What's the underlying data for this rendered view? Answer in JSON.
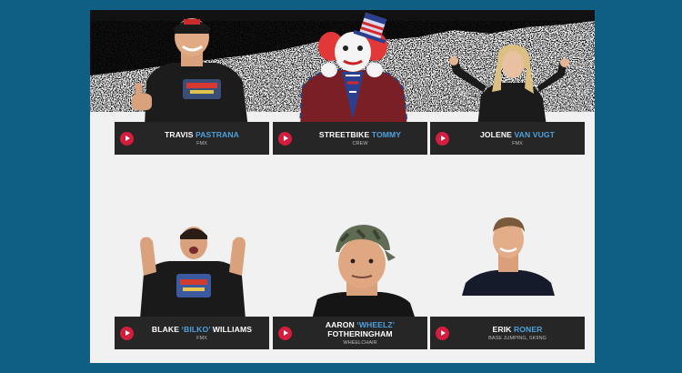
{
  "team": [
    {
      "first": "TRAVIS",
      "last": "PASTRANA",
      "role": "FMX"
    },
    {
      "first": "STREETBIKE",
      "last": "TOMMY",
      "role": "CREW"
    },
    {
      "first": "JOLENE",
      "last": "VAN VUGT",
      "role": "FMX"
    },
    {
      "first": "BLAKE",
      "last": "‘BILKO’",
      "last2": "WILLIAMS",
      "role": "FMX"
    },
    {
      "first": "AARON",
      "last": "‘WHEELZ’",
      "line2": "FOTHERINGHAM",
      "role": "WHEELCHAIR"
    },
    {
      "first": "ERIK",
      "last": "RONER",
      "role": "BASE JUMPING, SKIING"
    }
  ],
  "colors": {
    "background": "#0f5f85",
    "panel": "#f1f1f1",
    "card": "#262626",
    "play_button": "#d61d3d",
    "last_name_accent": "#4ea2dc"
  },
  "icons": {
    "play": "play-circle-icon"
  }
}
